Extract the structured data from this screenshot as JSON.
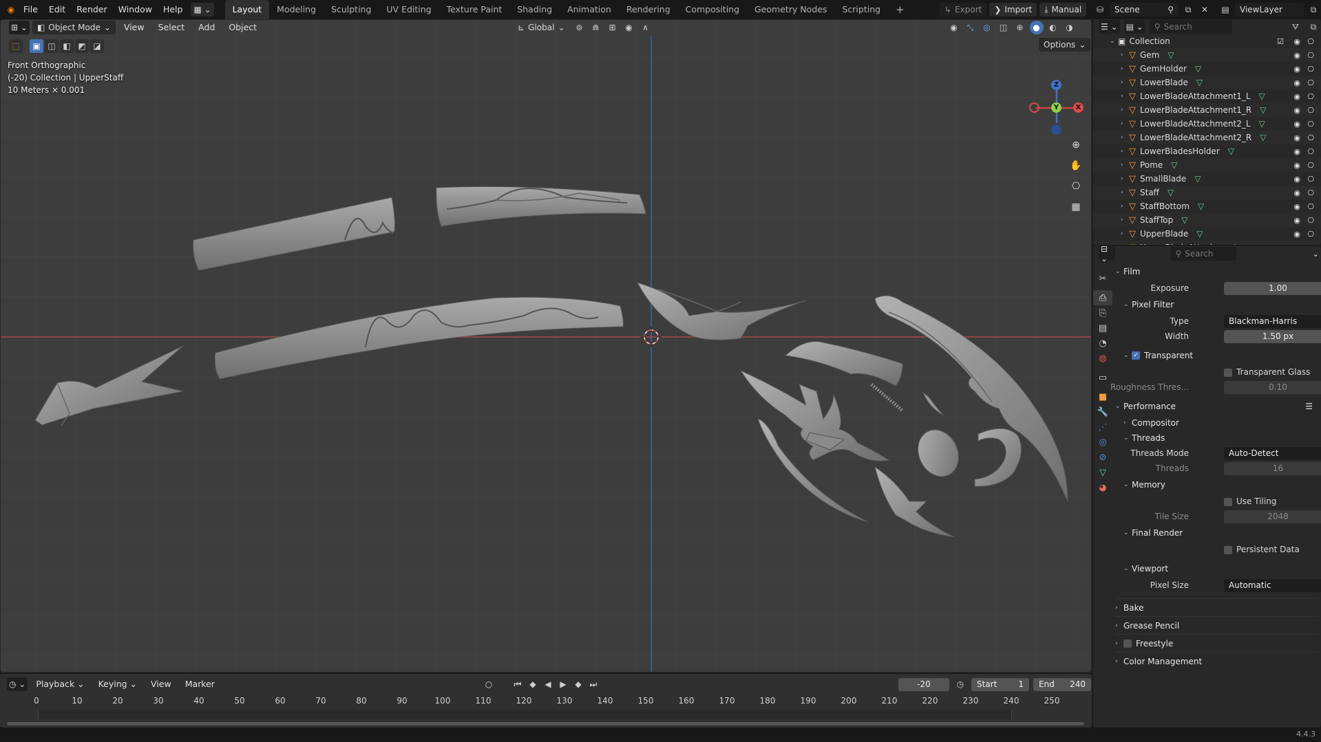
{
  "top_menu": [
    "File",
    "Edit",
    "Render",
    "Window",
    "Help"
  ],
  "workspaces": [
    "Layout",
    "Modeling",
    "Sculpting",
    "UV Editing",
    "Texture Paint",
    "Shading",
    "Animation",
    "Rendering",
    "Compositing",
    "Geometry Nodes",
    "Scripting"
  ],
  "active_workspace": "Layout",
  "top_right": {
    "export": "Export",
    "import": "Import",
    "manual": "Manual",
    "scene": "Scene",
    "view_layer": "ViewLayer"
  },
  "viewport_header": {
    "mode": "Object Mode",
    "menus": [
      "View",
      "Select",
      "Add",
      "Object"
    ],
    "transform_orientation": "Global",
    "options": "Options"
  },
  "viewport_overlay": {
    "view_name": "Front Orthographic",
    "collection_info": "(-20) Collection | UpperStaff",
    "scale": "10 Meters × 0.001"
  },
  "gizmo_axes": {
    "z": "Z",
    "y": "Y",
    "x": "X"
  },
  "outliner": {
    "search_placeholder": "Search",
    "collection": "Collection",
    "objects": [
      "Gem",
      "GemHolder",
      "LowerBlade",
      "LowerBladeAttachment1_L",
      "LowerBladeAttachment1_R",
      "LowerBladeAttachment2_L",
      "LowerBladeAttachment2_R",
      "LowerBladesHolder",
      "Pome",
      "SmallBlade",
      "Staff",
      "StaffBottom",
      "StaffTop",
      "UpperBlade",
      "UpperBladeAttachment"
    ]
  },
  "properties": {
    "search_placeholder": "Search",
    "film": {
      "title": "Film",
      "exposure_label": "Exposure",
      "exposure": "1.00",
      "pixel_filter": "Pixel Filter",
      "type_label": "Type",
      "type": "Blackman-Harris",
      "width_label": "Width",
      "width": "1.50 px",
      "transparent": "Transparent",
      "transparent_glass": "Transparent Glass",
      "roughness_label": "Roughness Thres...",
      "roughness": "0.10"
    },
    "performance": {
      "title": "Performance",
      "compositor": "Compositor",
      "threads": "Threads",
      "threads_mode_label": "Threads Mode",
      "threads_mode": "Auto-Detect",
      "threads_label": "Threads",
      "threads_value": "16",
      "memory": "Memory",
      "use_tiling": "Use Tiling",
      "tile_size_label": "Tile Size",
      "tile_size": "2048",
      "final_render": "Final Render",
      "persistent_data": "Persistent Data",
      "viewport": "Viewport",
      "pixel_size_label": "Pixel Size",
      "pixel_size": "Automatic"
    },
    "collapsed": [
      "Bake",
      "Grease Pencil",
      "Freestyle",
      "Color Management"
    ]
  },
  "timeline": {
    "menus": [
      "Playback",
      "Keying",
      "View",
      "Marker"
    ],
    "current_frame": "-20",
    "start_label": "Start",
    "start": "1",
    "end_label": "End",
    "end": "240",
    "ticks": [
      "0",
      "10",
      "20",
      "30",
      "40",
      "50",
      "60",
      "70",
      "80",
      "90",
      "100",
      "110",
      "120",
      "130",
      "140",
      "150",
      "160",
      "170",
      "180",
      "190",
      "200",
      "210",
      "220",
      "230",
      "240",
      "250"
    ]
  },
  "version": "4.4.3"
}
